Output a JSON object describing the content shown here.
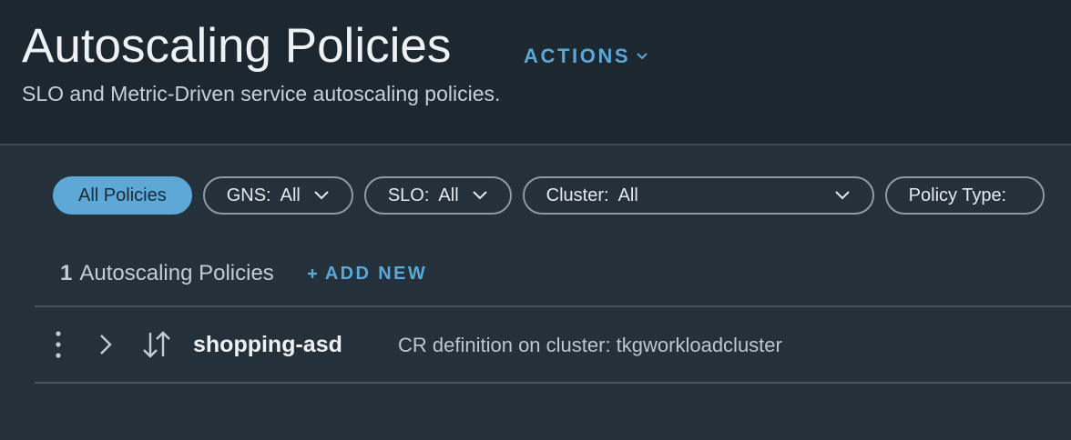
{
  "header": {
    "title": "Autoscaling Policies",
    "actions_label": "ACTIONS",
    "subtitle": "SLO and Metric-Driven service autoscaling policies."
  },
  "filters": {
    "all_label": "All Policies",
    "gns": {
      "label": "GNS:",
      "value": "All"
    },
    "slo": {
      "label": "SLO:",
      "value": "All"
    },
    "cluster": {
      "label": "Cluster:",
      "value": "All"
    },
    "policy_type": {
      "label": "Policy Type:"
    }
  },
  "list": {
    "count": "1",
    "count_label": "Autoscaling Policies",
    "add_new_label": "ADD NEW",
    "rows": [
      {
        "name": "shopping-asd",
        "description": "CR definition on cluster: tkgworkloadcluster"
      }
    ]
  },
  "colors": {
    "accent": "#5aa8d8",
    "header_bg": "#1c2730",
    "body_bg": "#25313a"
  },
  "icons": [
    "chevron-down-icon",
    "plus-icon",
    "kebab-menu-icon",
    "chevron-right-icon",
    "sort-arrows-icon"
  ]
}
